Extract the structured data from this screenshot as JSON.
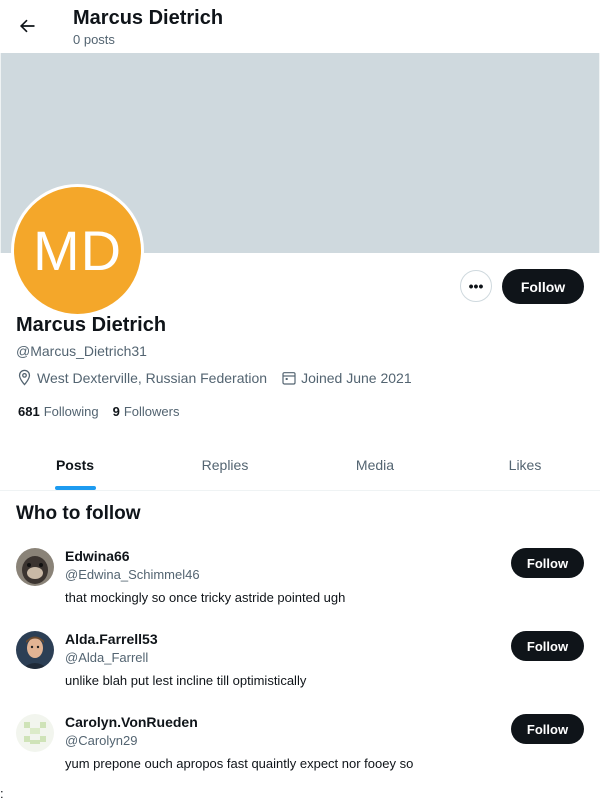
{
  "header": {
    "title": "Marcus Dietrich",
    "subtitle": "0 posts"
  },
  "profile": {
    "initials": "MD",
    "avatar_color": "#f4a72a",
    "banner_color": "#cfd9de",
    "display_name": "Marcus Dietrich",
    "handle": "@Marcus_Dietrich31",
    "location": "West Dexterville, Russian Federation",
    "joined": "Joined June 2021",
    "following_count": "681",
    "following_label": "Following",
    "followers_count": "9",
    "followers_label": "Followers",
    "follow_label": "Follow",
    "more_label": "•••"
  },
  "tabs": [
    {
      "label": "Posts",
      "active": true
    },
    {
      "label": "Replies",
      "active": false
    },
    {
      "label": "Media",
      "active": false
    },
    {
      "label": "Likes",
      "active": false
    }
  ],
  "who_to_follow": {
    "title": "Who to follow",
    "items": [
      {
        "name": "Edwina66",
        "handle": "@Edwina_Schimmel46",
        "bio": "that mockingly so once tricky astride pointed ugh",
        "follow_label": "Follow"
      },
      {
        "name": "Alda.Farrell53",
        "handle": "@Alda_Farrell",
        "bio": "unlike blah put lest incline till optimistically",
        "follow_label": "Follow"
      },
      {
        "name": "Carolyn.VonRueden",
        "handle": "@Carolyn29",
        "bio": "yum prepone ouch apropos fast quaintly expect nor fooey so",
        "follow_label": "Follow"
      }
    ]
  },
  "stray_text": ":"
}
